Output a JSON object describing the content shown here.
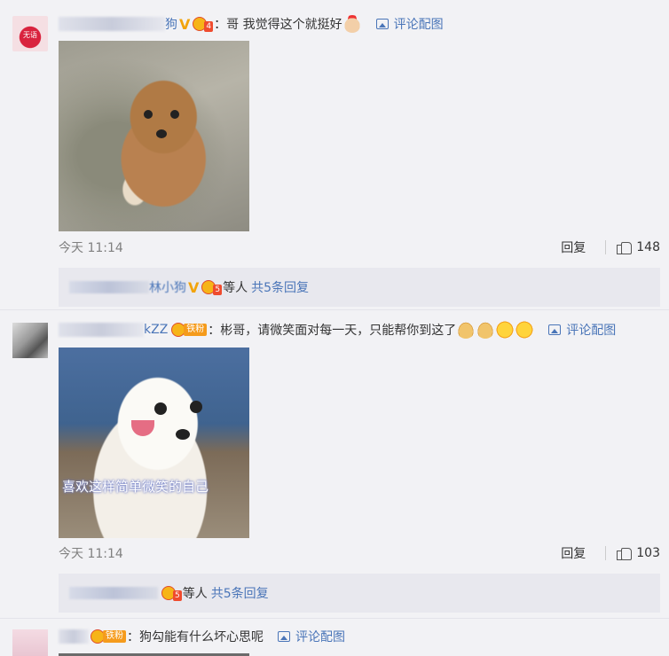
{
  "comments": [
    {
      "user_visible": "狗",
      "text": "：哥 我觉得这个就挺好",
      "pic_link": "评论配图",
      "time": "今天 11:14",
      "reply_label": "回复",
      "likes": "148",
      "sub_replies": {
        "user_visible": "林小狗",
        "suffix": "等人",
        "more": "共5条回复"
      },
      "avatar_text": "无语"
    },
    {
      "user_visible": "kZZ",
      "fan_tag": "铁粉",
      "text": "：彬哥，请微笑面对每一天，只能帮你到这了",
      "pic_link": "评论配图",
      "caption": "喜欢这样简单微笑的自己",
      "time": "今天 11:14",
      "reply_label": "回复",
      "likes": "103",
      "sub_replies": {
        "suffix": "等人",
        "more": "共5条回复"
      }
    },
    {
      "fan_tag": "铁粉",
      "text": "：狗勾能有什么坏心思呢",
      "pic_link": "评论配图"
    }
  ],
  "icons": [
    "verified-v-icon",
    "fan-level-badge-icon",
    "image-icon",
    "thumb-up-icon"
  ],
  "colors": {
    "link": "#4a75b8",
    "background": "#f2f2f5",
    "badge_gold": "#f2a40c"
  }
}
